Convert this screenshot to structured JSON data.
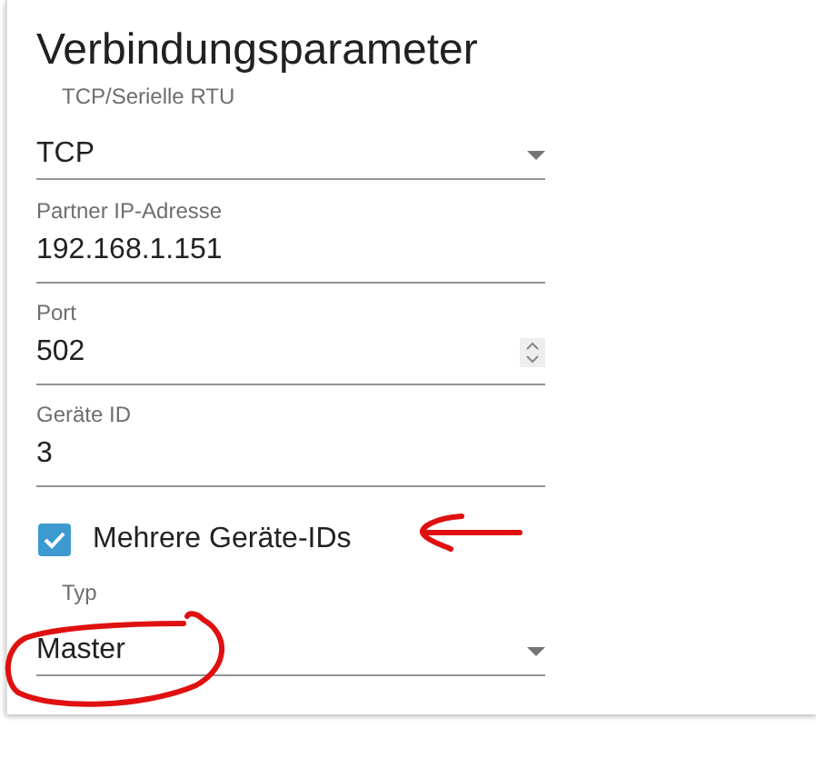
{
  "title": "Verbindungsparameter",
  "fields": [
    {
      "kind": "select",
      "label": "TCP/Serielle RTU",
      "value": "TCP"
    },
    {
      "kind": "text",
      "label": "Partner IP-Adresse",
      "value": "192.168.1.151"
    },
    {
      "kind": "number",
      "label": "Port",
      "value": "502"
    },
    {
      "kind": "text",
      "label": "Geräte ID",
      "value": "3"
    },
    {
      "kind": "checkbox",
      "label": "Mehrere Geräte-IDs",
      "checked": true
    },
    {
      "kind": "select",
      "label": "Typ",
      "value": "Master"
    }
  ],
  "annotations": [
    {
      "kind": "arrow"
    },
    {
      "kind": "circle"
    }
  ]
}
